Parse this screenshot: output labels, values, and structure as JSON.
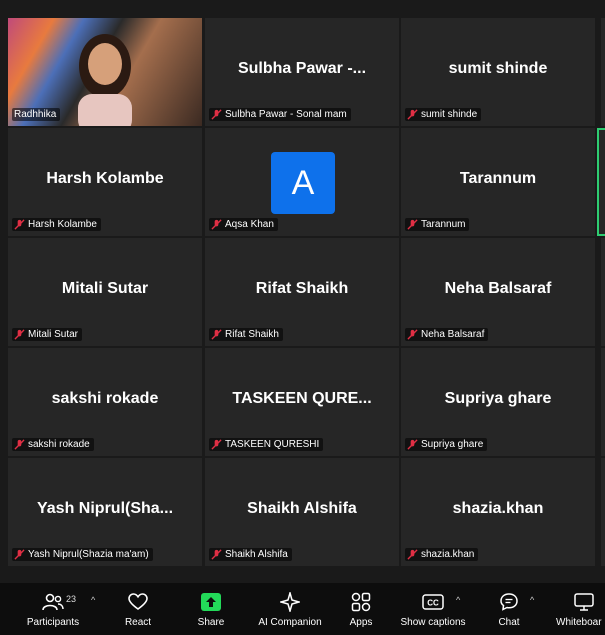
{
  "tiles": [
    {
      "id": "radhika",
      "label": "Radhhika",
      "video": true
    },
    {
      "id": "sulbha",
      "name": "Sulbha  Pawar  -...",
      "label": "Sulbha Pawar - Sonal mam"
    },
    {
      "id": "sumit",
      "name": "sumit shinde",
      "label": "sumit shinde"
    },
    {
      "id": "harsh",
      "name": "Harsh Kolambe",
      "label": "Harsh Kolambe"
    },
    {
      "id": "aqsa",
      "avatar_letter": "A",
      "label": "Aqsa Khan"
    },
    {
      "id": "tarannum",
      "name": "Tarannum",
      "label": "Tarannum"
    },
    {
      "id": "mitali",
      "name": "Mitali Sutar",
      "label": "Mitali Sutar"
    },
    {
      "id": "rifat",
      "name": "Rifat Shaikh",
      "label": "Rifat Shaikh"
    },
    {
      "id": "neha",
      "name": "Neha Balsaraf",
      "label": "Neha Balsaraf"
    },
    {
      "id": "sakshi",
      "name": "sakshi rokade",
      "label": "sakshi rokade"
    },
    {
      "id": "taskeen",
      "name": "TASKEEN  QURE...",
      "label": "TASKEEN QURESHI"
    },
    {
      "id": "supriya",
      "name": "Supriya ghare",
      "label": "Supriya ghare"
    },
    {
      "id": "yash",
      "name": "Yash  Niprul(Sha...",
      "label": "Yash Niprul(Shazia ma'am)"
    },
    {
      "id": "alshifa",
      "name": "Shaikh Alshifa",
      "label": "Shaikh Alshifa"
    },
    {
      "id": "shazia",
      "name": "shazia.khan",
      "label": "shazia.khan"
    }
  ],
  "toolbar": {
    "participants_label": "Participants",
    "participants_count": "23",
    "react_label": "React",
    "share_label": "Share",
    "ai_label": "AI Companion",
    "apps_label": "Apps",
    "captions_label": "Show captions",
    "chat_label": "Chat",
    "whiteboard_label": "Whiteboar"
  },
  "colors": {
    "muted_icon": "#e02f44",
    "share_green": "#23d959",
    "avatar_blue": "#0e71eb",
    "active_border": "#2ecc71"
  }
}
